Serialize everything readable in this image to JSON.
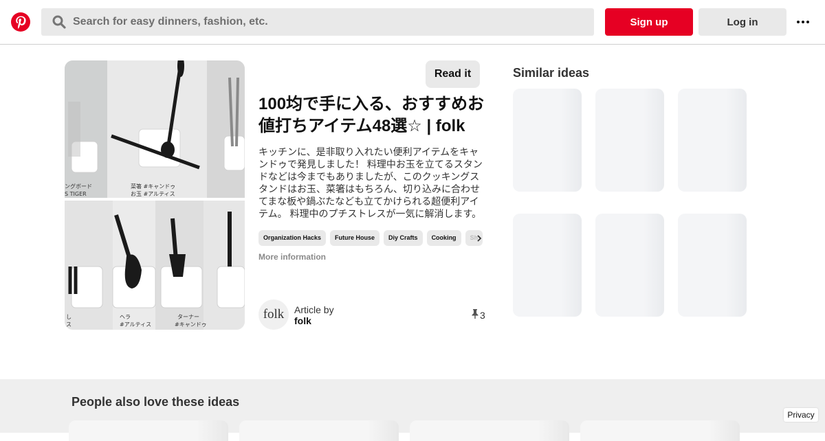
{
  "header": {
    "logo_icon": "pinterest-logo-icon",
    "search_icon": "search-icon",
    "search_placeholder": "Search for easy dinners, fashion, etc.",
    "signup_label": "Sign up",
    "login_label": "Log in",
    "more_icon": "more-horizontal-icon"
  },
  "pin": {
    "image_labels": {
      "label_1": "ングボード",
      "label_2": "S TIGER",
      "label_3": "菜箸 #キャンドゥ",
      "label_4": "お玉 #アルティス",
      "label_5": "ヘラ",
      "label_6": "#アルティス",
      "label_7": "ターナー",
      "label_8": "#キャンドゥ",
      "label_9": "し",
      "label_10": "ス"
    },
    "read_it_label": "Read it",
    "title": "100均で手に入る、おすすめお値打ちアイテム48選☆ | folk",
    "description": "キッチンに、是非取り入れたい便利アイテムをキャンドゥで発見しました！ 料理中お玉を立てるスタンドなどは今までもありましたが、このクッキングスタンドはお玉、菜箸はもちろん、切り込みに合わせてまな板や鍋ぶたなども立てかけられる超便利アイテム。 料理中のプチストレスが一気に解消します。",
    "tags": [
      "Organization Hacks",
      "Future House",
      "Diy Crafts",
      "Cooking",
      "Sh"
    ],
    "tags_arrow_icon": "chevron-right-icon",
    "more_info_label": "More information",
    "author": {
      "avatar_text": "folk",
      "article_by_label": "Article by",
      "name": "folk"
    },
    "saves_icon": "pin-icon",
    "saves_count": "3"
  },
  "similar": {
    "title": "Similar ideas"
  },
  "bottom": {
    "title": "People also love these ideas",
    "privacy_label": "Privacy"
  },
  "colors": {
    "brand_red": "#e60023",
    "button_gray": "#e9e9e9",
    "section_gray": "#efefef"
  }
}
